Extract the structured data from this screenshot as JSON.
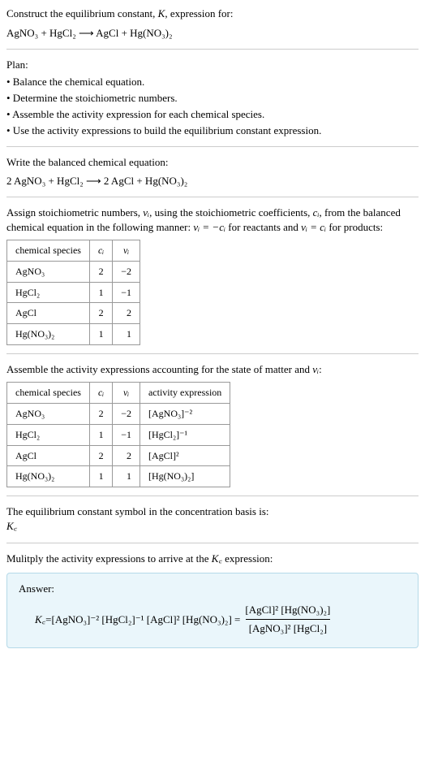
{
  "header": {
    "prompt_prefix": "Construct the equilibrium constant, ",
    "prompt_K": "K",
    "prompt_suffix": ", expression for:",
    "equation": "AgNO₃ + HgCl₂ ⟶ AgCl + Hg(NO₃)₂"
  },
  "plan": {
    "title": "Plan:",
    "bullets": [
      "• Balance the chemical equation.",
      "• Determine the stoichiometric numbers.",
      "• Assemble the activity expression for each chemical species.",
      "• Use the activity expressions to build the equilibrium constant expression."
    ]
  },
  "balanced": {
    "title": "Write the balanced chemical equation:",
    "equation": "2 AgNO₃ + HgCl₂ ⟶ 2 AgCl + Hg(NO₃)₂"
  },
  "stoich": {
    "text1": "Assign stoichiometric numbers, ",
    "nu": "νᵢ",
    "text2": ", using the stoichiometric coefficients, ",
    "ci": "cᵢ",
    "text3": ", from the balanced chemical equation in the following manner: ",
    "eq1": "νᵢ = −cᵢ",
    "text4": " for reactants and ",
    "eq2": "νᵢ = cᵢ",
    "text5": " for products:",
    "headers": {
      "species": "chemical species",
      "ci": "cᵢ",
      "nu": "νᵢ"
    },
    "rows": [
      {
        "species": "AgNO₃",
        "ci": "2",
        "nu": "−2"
      },
      {
        "species": "HgCl₂",
        "ci": "1",
        "nu": "−1"
      },
      {
        "species": "AgCl",
        "ci": "2",
        "nu": "2"
      },
      {
        "species": "Hg(NO₃)₂",
        "ci": "1",
        "nu": "1"
      }
    ]
  },
  "activity": {
    "title_prefix": "Assemble the activity expressions accounting for the state of matter and ",
    "title_nu": "νᵢ",
    "title_suffix": ":",
    "headers": {
      "species": "chemical species",
      "ci": "cᵢ",
      "nu": "νᵢ",
      "act": "activity expression"
    },
    "rows": [
      {
        "species": "AgNO₃",
        "ci": "2",
        "nu": "−2",
        "act": "[AgNO₃]⁻²"
      },
      {
        "species": "HgCl₂",
        "ci": "1",
        "nu": "−1",
        "act": "[HgCl₂]⁻¹"
      },
      {
        "species": "AgCl",
        "ci": "2",
        "nu": "2",
        "act": "[AgCl]²"
      },
      {
        "species": "Hg(NO₃)₂",
        "ci": "1",
        "nu": "1",
        "act": "[Hg(NO₃)₂]"
      }
    ]
  },
  "basis": {
    "text": "The equilibrium constant symbol in the concentration basis is:",
    "symbol": "K꜀"
  },
  "multiply": {
    "text_prefix": "Mulitply the activity expressions to arrive at the ",
    "kc": "K꜀",
    "text_suffix": " expression:"
  },
  "answer": {
    "label": "Answer:",
    "kc": "K꜀",
    "eq": " = ",
    "terms": "[AgNO₃]⁻² [HgCl₂]⁻¹ [AgCl]² [Hg(NO₃)₂] = ",
    "num": "[AgCl]² [Hg(NO₃)₂]",
    "den": "[AgNO₃]² [HgCl₂]"
  }
}
